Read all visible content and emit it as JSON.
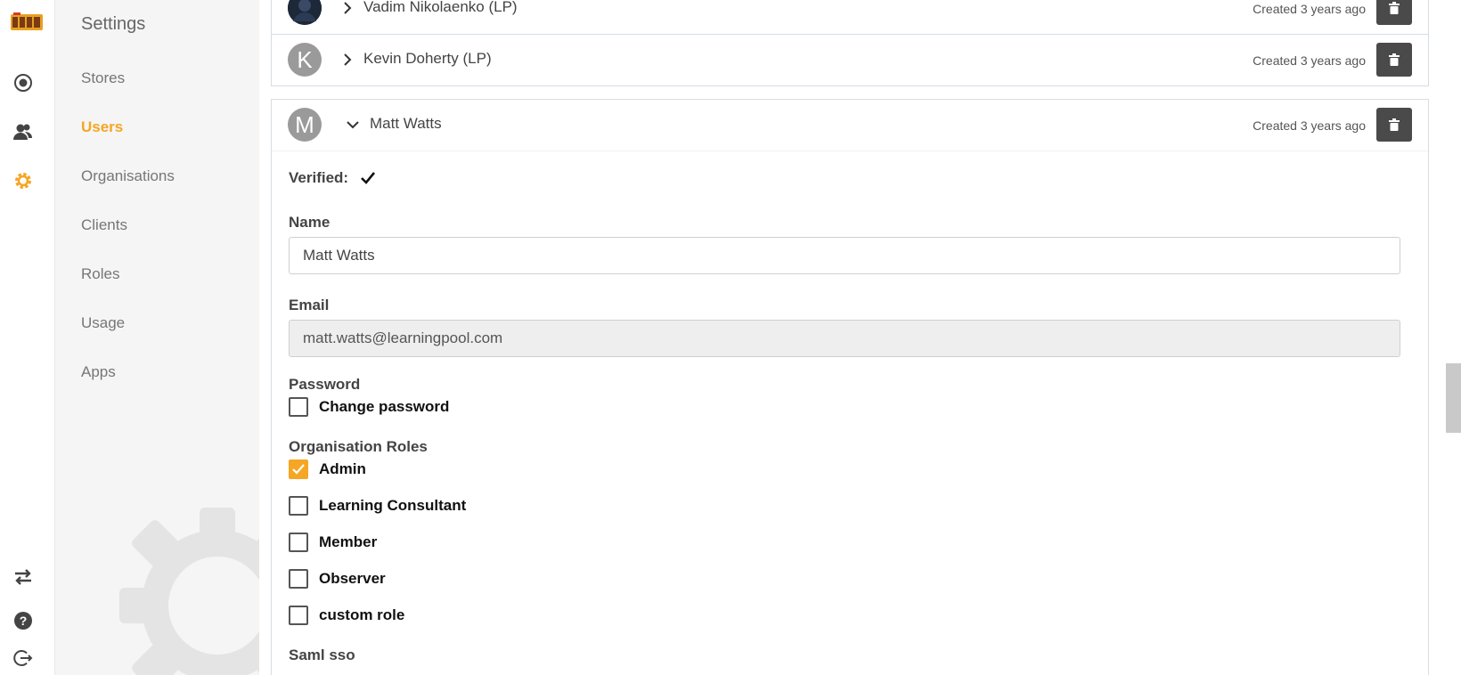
{
  "rail": {
    "icons": [
      "logo-icon",
      "dashboard-icon",
      "people-icon",
      "gear-icon",
      "swap-icon",
      "help-icon",
      "logout-icon"
    ],
    "accent": "#f5a623"
  },
  "sidebar": {
    "title": "Settings",
    "items": [
      {
        "label": "Stores",
        "active": false
      },
      {
        "label": "Users",
        "active": true
      },
      {
        "label": "Organisations",
        "active": false
      },
      {
        "label": "Clients",
        "active": false
      },
      {
        "label": "Roles",
        "active": false
      },
      {
        "label": "Usage",
        "active": false
      },
      {
        "label": "Apps",
        "active": false
      }
    ]
  },
  "users": [
    {
      "initial": "",
      "name": "Vadim Nikolaenko (LP)",
      "created": "Created 3 years ago",
      "expanded": false
    },
    {
      "initial": "K",
      "name": "Kevin Doherty (LP)",
      "created": "Created 3 years ago",
      "expanded": false
    },
    {
      "initial": "M",
      "name": "Matt Watts",
      "created": "Created 3 years ago",
      "expanded": true
    }
  ],
  "detail": {
    "verified_label": "Verified:",
    "verified": true,
    "name_label": "Name",
    "name_value": "Matt Watts",
    "email_label": "Email",
    "email_value": "matt.watts@learningpool.com",
    "password_label": "Password",
    "change_password_label": "Change password",
    "change_password_checked": false,
    "roles_label": "Organisation Roles",
    "roles": [
      {
        "label": "Admin",
        "checked": true
      },
      {
        "label": "Learning Consultant",
        "checked": false
      },
      {
        "label": "Member",
        "checked": false
      },
      {
        "label": "Observer",
        "checked": false
      },
      {
        "label": "custom role",
        "checked": false
      }
    ],
    "saml_label": "Saml sso"
  }
}
